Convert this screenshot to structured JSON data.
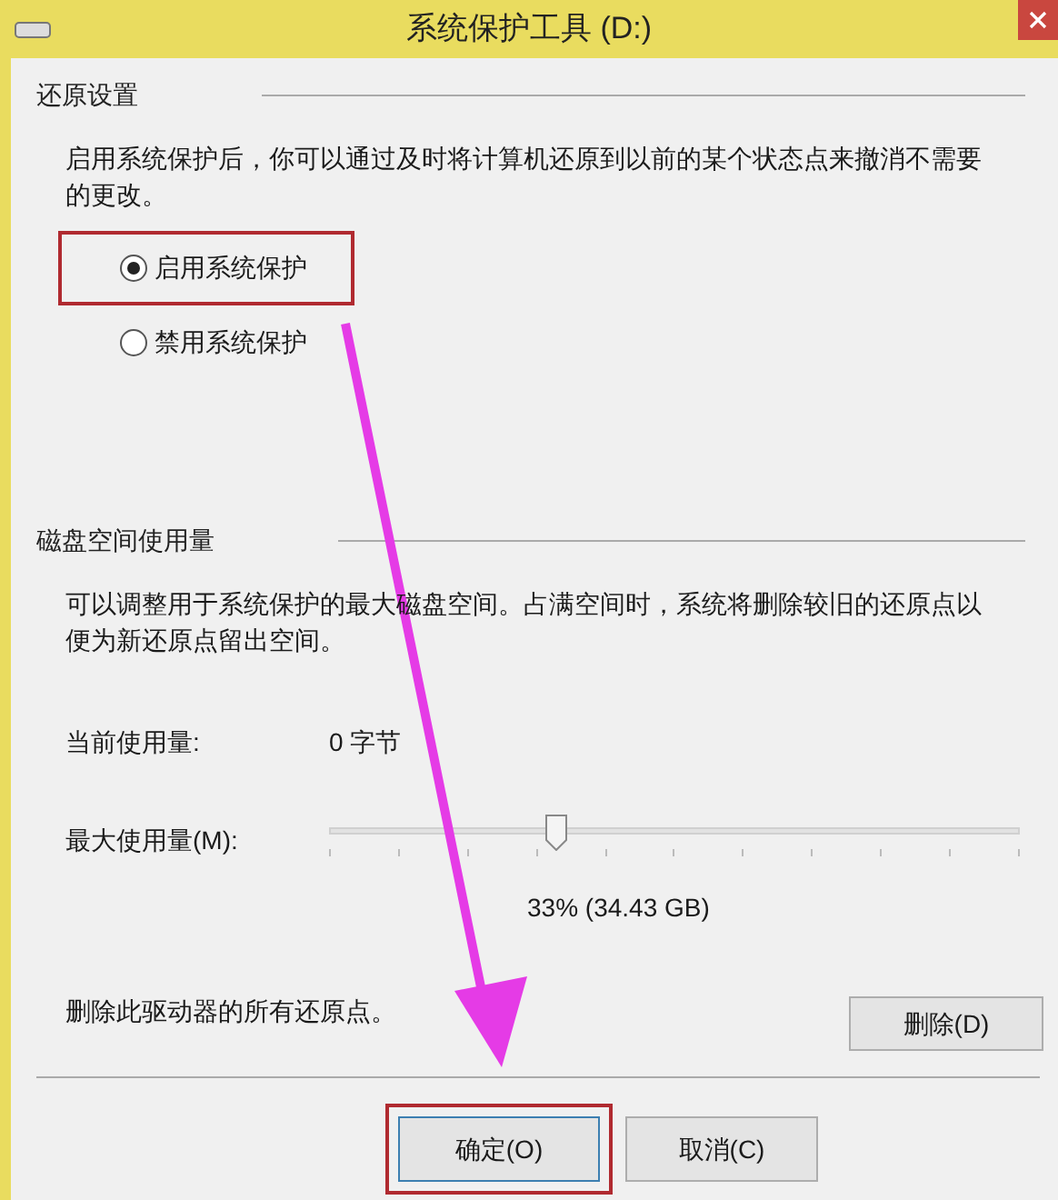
{
  "window": {
    "title": "系统保护工具 (D:)"
  },
  "restore_settings": {
    "heading": "还原设置",
    "description": "启用系统保护后，你可以通过及时将计算机还原到以前的某个状态点来撤消不需要的更改。",
    "options": [
      {
        "label": "启用系统保护",
        "selected": true,
        "highlighted": true
      },
      {
        "label": "禁用系统保护",
        "selected": false,
        "highlighted": false
      }
    ]
  },
  "disk_usage": {
    "heading": "磁盘空间使用量",
    "description": "可以调整用于系统保护的最大磁盘空间。占满空间时，系统将删除较旧的还原点以便为新还原点留出空间。",
    "current_label": "当前使用量:",
    "current_value": "0 字节",
    "max_label": "最大使用量(M):",
    "max_slider": {
      "level": 0.33
    },
    "max_reading": "33% (34.43 GB)",
    "delete_text": "删除此驱动器的所有还原点。",
    "delete_button": "删除(D)"
  },
  "buttons": [
    {
      "label": "确定(O)",
      "highlighted": true
    },
    {
      "label": "取消(C)",
      "highlighted": false
    }
  ]
}
